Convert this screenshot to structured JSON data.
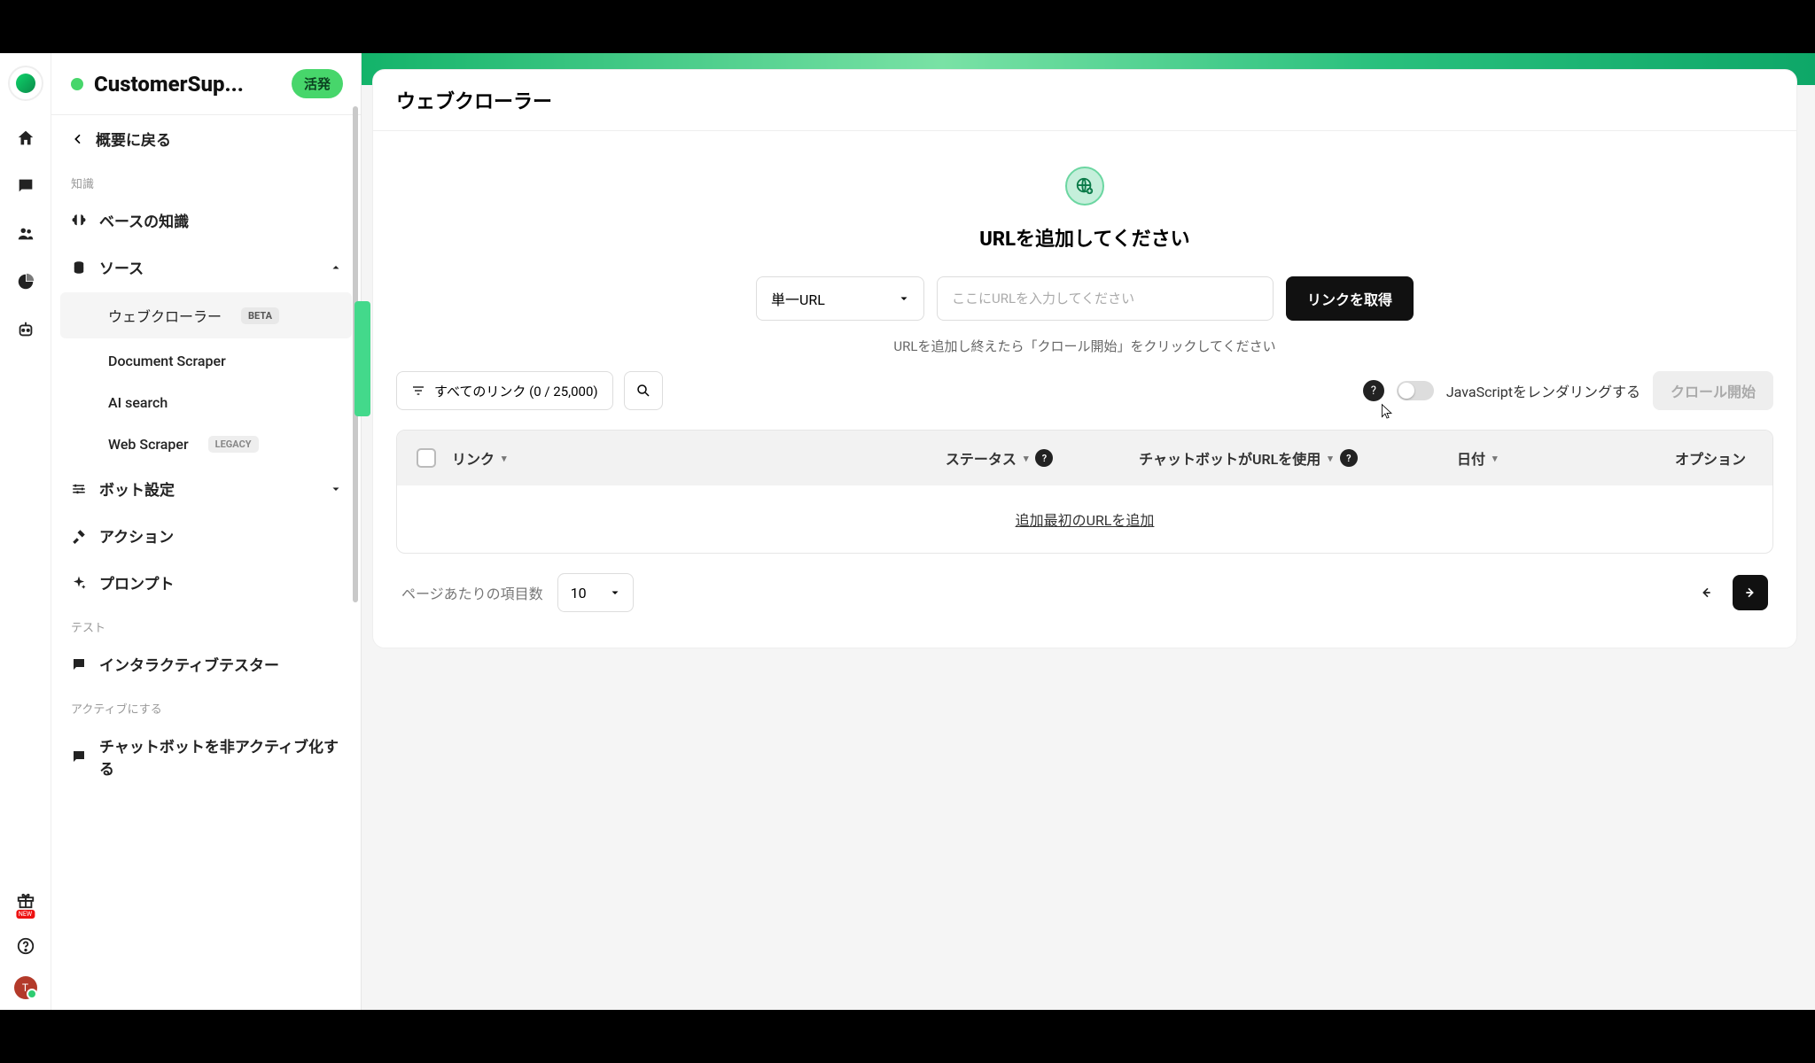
{
  "icon_rail": {
    "avatar_initial": "T"
  },
  "sidebar": {
    "project_title": "CustomerSup...",
    "status_badge": "活発",
    "back_label": "概要に戻る",
    "section_knowledge": "知識",
    "items": {
      "base_knowledge": "ベースの知識",
      "sources": "ソース",
      "web_crawler": "ウェブクローラー",
      "web_crawler_badge": "BETA",
      "doc_scraper": "Document Scraper",
      "ai_search": "AI search",
      "web_scraper": "Web Scraper",
      "web_scraper_badge": "LEGACY",
      "bot_settings": "ボット設定",
      "actions": "アクション",
      "prompt": "プロンプト"
    },
    "section_test": "テスト",
    "interactive_tester": "インタラクティブテスター",
    "section_activate": "アクティブにする",
    "deactivate": "チャットボットを非アクティブ化する"
  },
  "main": {
    "page_title": "ウェブクローラー",
    "hero_heading": "URLを追加してください",
    "url_type": "単一URL",
    "url_placeholder": "ここにURLを入力してください",
    "get_links_btn": "リンクを取得",
    "hint": "URLを追加し終えたら「クロール開始」をクリックしてください",
    "all_links_filter": "すべてのリンク (0 / 25,000)",
    "js_render_label": "JavaScriptをレンダリングする",
    "start_crawl_btn": "クロール開始",
    "table": {
      "col_link": "リンク",
      "col_status": "ステータス",
      "col_used": "チャットボットがURLを使用",
      "col_date": "日付",
      "col_options": "オプション",
      "empty": "追加最初のURLを追加"
    },
    "per_page_label": "ページあたりの項目数",
    "per_page_value": "10"
  }
}
